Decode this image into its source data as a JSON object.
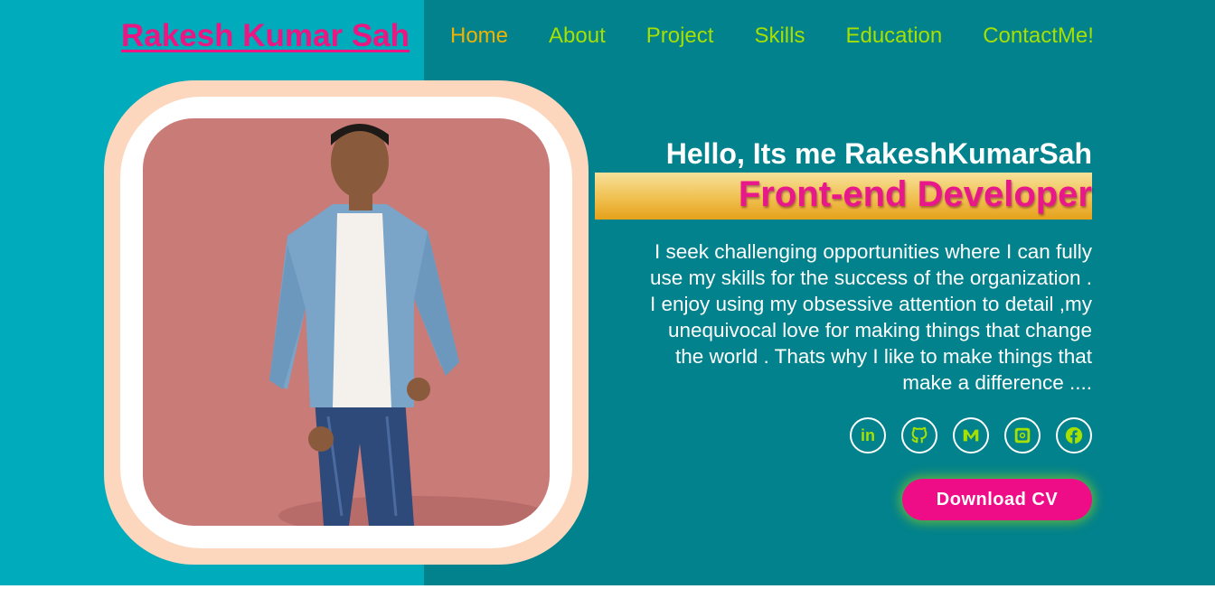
{
  "brand": {
    "name": "Rakesh Kumar Sah"
  },
  "nav": {
    "items": [
      {
        "label": "Home"
      },
      {
        "label": "About"
      },
      {
        "label": "Project"
      },
      {
        "label": "Skills"
      },
      {
        "label": "Education"
      },
      {
        "label": "ContactMe!"
      }
    ]
  },
  "hero": {
    "greeting": "Hello, Its me RakeshKumarSah",
    "role": "Front-end Developer",
    "bio_lines": [
      "I seek challenging opportunities where I can fully",
      "use my skills for the success of the organization .",
      "I enjoy using my obsessive attention to detail ,my",
      "unequivocal love for making things that change",
      "the world . Thats why I like to make things that",
      "make a difference ...."
    ],
    "socials": [
      {
        "icon": "linkedin-icon",
        "glyph": "in"
      },
      {
        "icon": "github-icon"
      },
      {
        "icon": "medium-icon"
      },
      {
        "icon": "instagram-icon"
      },
      {
        "icon": "facebook-icon"
      }
    ],
    "cta": "Download CV"
  },
  "colors": {
    "accent_pink": "#ee0d86",
    "nav_green": "#a6e000",
    "nav_active": "#f0b400",
    "left_panel": "#00abbb",
    "right_panel": "#02828c",
    "frame_peach": "#fcd7be",
    "photo_bg": "#c97b78"
  }
}
